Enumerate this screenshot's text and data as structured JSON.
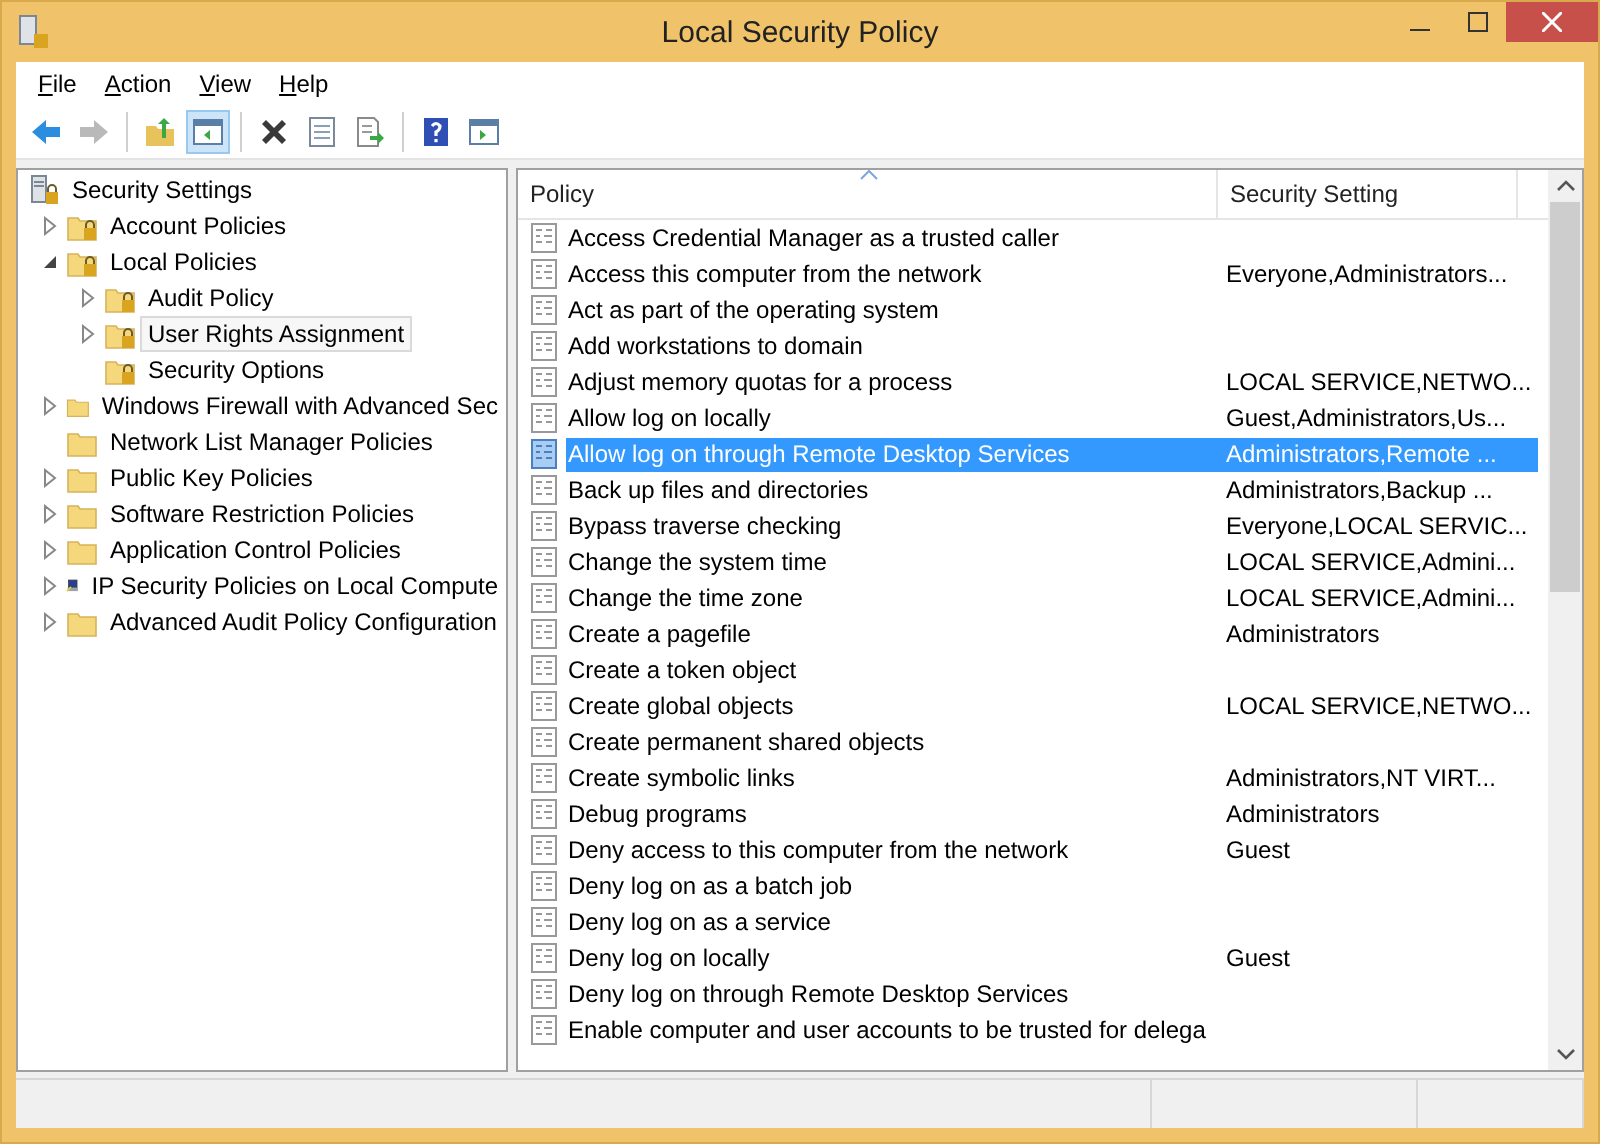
{
  "window": {
    "title": "Local Security Policy"
  },
  "menu": [
    {
      "label": "File"
    },
    {
      "label": "Action"
    },
    {
      "label": "View"
    },
    {
      "label": "Help"
    }
  ],
  "toolbar": [
    {
      "kind": "back",
      "disabled": false,
      "pressed": false
    },
    {
      "kind": "forward",
      "disabled": true,
      "pressed": false
    },
    {
      "kind": "separator"
    },
    {
      "kind": "up",
      "disabled": false,
      "pressed": false
    },
    {
      "kind": "tree",
      "disabled": false,
      "pressed": true
    },
    {
      "kind": "separator"
    },
    {
      "kind": "delete",
      "disabled": false,
      "pressed": false
    },
    {
      "kind": "properties",
      "disabled": false,
      "pressed": false
    },
    {
      "kind": "export",
      "disabled": false,
      "pressed": false
    },
    {
      "kind": "separator"
    },
    {
      "kind": "help",
      "disabled": false,
      "pressed": false
    },
    {
      "kind": "actionpane",
      "disabled": false,
      "pressed": false
    }
  ],
  "tree": [
    {
      "label": "Security Settings",
      "kind": "security",
      "selected": false,
      "children": [
        {
          "label": "Account Policies",
          "kind": "locked-folder",
          "expanded": false,
          "selected": false
        },
        {
          "label": "Local Policies",
          "kind": "locked-folder",
          "expanded": true,
          "selected": false,
          "children": [
            {
              "label": "Audit Policy",
              "kind": "locked-folder",
              "expanded": false,
              "selected": false
            },
            {
              "label": "User Rights Assignment",
              "kind": "locked-folder",
              "expanded": false,
              "selected": true
            },
            {
              "label": "Security Options",
              "kind": "locked-folder",
              "selected": false
            }
          ]
        },
        {
          "label": "Windows Firewall with Advanced Sec",
          "kind": "folder",
          "expanded": false,
          "selected": false
        },
        {
          "label": "Network List Manager Policies",
          "kind": "folder",
          "selected": false
        },
        {
          "label": "Public Key Policies",
          "kind": "folder",
          "expanded": false,
          "selected": false
        },
        {
          "label": "Software Restriction Policies",
          "kind": "folder",
          "expanded": false,
          "selected": false
        },
        {
          "label": "Application Control Policies",
          "kind": "folder",
          "expanded": false,
          "selected": false
        },
        {
          "label": "IP Security Policies on Local Compute",
          "kind": "ip-security",
          "expanded": false,
          "selected": false
        },
        {
          "label": "Advanced Audit Policy Configuration",
          "kind": "folder",
          "expanded": false,
          "selected": false
        }
      ]
    }
  ],
  "table": {
    "columns": [
      {
        "label": "Policy",
        "sorted": true
      },
      {
        "label": "Security Setting",
        "sorted": false
      }
    ],
    "rows": [
      {
        "policy": "Access Credential Manager as a trusted caller",
        "setting": "",
        "selected": false
      },
      {
        "policy": "Access this computer from the network",
        "setting": "Everyone,Administrators...",
        "selected": false
      },
      {
        "policy": "Act as part of the operating system",
        "setting": "",
        "selected": false
      },
      {
        "policy": "Add workstations to domain",
        "setting": "",
        "selected": false
      },
      {
        "policy": "Adjust memory quotas for a process",
        "setting": "LOCAL SERVICE,NETWO...",
        "selected": false
      },
      {
        "policy": "Allow log on locally",
        "setting": "Guest,Administrators,Us...",
        "selected": false
      },
      {
        "policy": "Allow log on through Remote Desktop Services",
        "setting": "Administrators,Remote ...",
        "selected": true
      },
      {
        "policy": "Back up files and directories",
        "setting": "Administrators,Backup ...",
        "selected": false
      },
      {
        "policy": "Bypass traverse checking",
        "setting": "Everyone,LOCAL SERVIC...",
        "selected": false
      },
      {
        "policy": "Change the system time",
        "setting": "LOCAL SERVICE,Admini...",
        "selected": false
      },
      {
        "policy": "Change the time zone",
        "setting": "LOCAL SERVICE,Admini...",
        "selected": false
      },
      {
        "policy": "Create a pagefile",
        "setting": "Administrators",
        "selected": false
      },
      {
        "policy": "Create a token object",
        "setting": "",
        "selected": false
      },
      {
        "policy": "Create global objects",
        "setting": "LOCAL SERVICE,NETWO...",
        "selected": false
      },
      {
        "policy": "Create permanent shared objects",
        "setting": "",
        "selected": false
      },
      {
        "policy": "Create symbolic links",
        "setting": "Administrators,NT VIRT...",
        "selected": false
      },
      {
        "policy": "Debug programs",
        "setting": "Administrators",
        "selected": false
      },
      {
        "policy": "Deny access to this computer from the network",
        "setting": "Guest",
        "selected": false
      },
      {
        "policy": "Deny log on as a batch job",
        "setting": "",
        "selected": false
      },
      {
        "policy": "Deny log on as a service",
        "setting": "",
        "selected": false
      },
      {
        "policy": "Deny log on locally",
        "setting": "Guest",
        "selected": false
      },
      {
        "policy": "Deny log on through Remote Desktop Services",
        "setting": "",
        "selected": false
      },
      {
        "policy": "Enable computer and user accounts to be trusted for delega",
        "setting": "",
        "selected": false
      }
    ]
  }
}
